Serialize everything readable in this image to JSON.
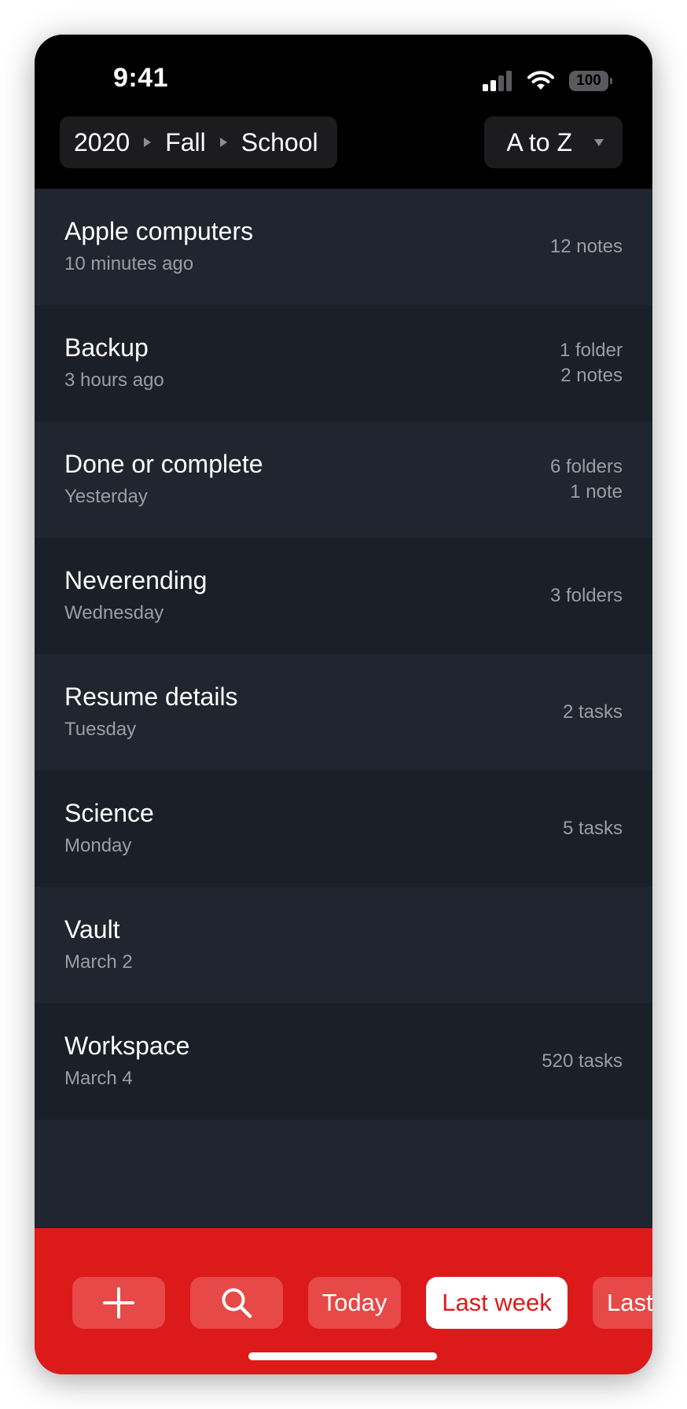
{
  "status_bar": {
    "time": "9:41",
    "battery": "100"
  },
  "header": {
    "breadcrumb": [
      "2020",
      "Fall",
      "School"
    ],
    "sort_label": "A to Z"
  },
  "items": [
    {
      "title": "Apple computers",
      "subtitle": "10 minutes ago",
      "meta": [
        "12 notes"
      ]
    },
    {
      "title": "Backup",
      "subtitle": "3 hours ago",
      "meta": [
        "1 folder",
        "2 notes"
      ]
    },
    {
      "title": "Done or complete",
      "subtitle": "Yesterday",
      "meta": [
        "6 folders",
        "1 note"
      ]
    },
    {
      "title": "Neverending",
      "subtitle": "Wednesday",
      "meta": [
        "3 folders"
      ]
    },
    {
      "title": "Resume details",
      "subtitle": "Tuesday",
      "meta": [
        "2 tasks"
      ]
    },
    {
      "title": "Science",
      "subtitle": "Monday",
      "meta": [
        "5 tasks"
      ]
    },
    {
      "title": "Vault",
      "subtitle": "March 2",
      "meta": []
    },
    {
      "title": "Workspace",
      "subtitle": "March 4",
      "meta": [
        "520 tasks"
      ]
    }
  ],
  "toolbar": {
    "today_label": "Today",
    "last_week_label": "Last week",
    "last_label": "Last",
    "active": "Last week"
  },
  "colors": {
    "accent": "#dc1a1a",
    "background": "#1f232c"
  }
}
